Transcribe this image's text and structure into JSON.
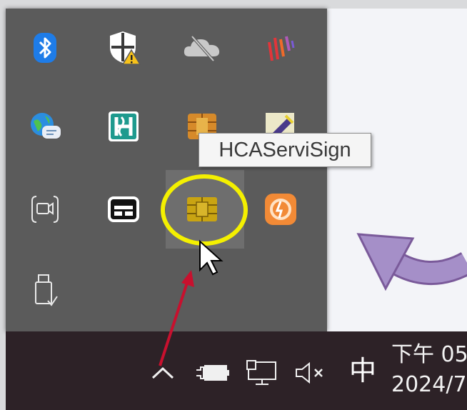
{
  "tooltip": {
    "text": "HCAServiSign"
  },
  "tray": {
    "icons": [
      {
        "name": "bluetooth-icon",
        "row": 1,
        "col": 1
      },
      {
        "name": "windows-security-warning-icon",
        "row": 1,
        "col": 2
      },
      {
        "name": "onedrive-offline-icon",
        "row": 1,
        "col": 3
      },
      {
        "name": "app-stripes-icon",
        "row": 1,
        "col": 4
      },
      {
        "name": "globe-chat-icon",
        "row": 2,
        "col": 1
      },
      {
        "name": "bank-h-logo-icon",
        "row": 2,
        "col": 2
      },
      {
        "name": "chip-card-orange-icon",
        "row": 2,
        "col": 3
      },
      {
        "name": "pen-tool-icon",
        "row": 2,
        "col": 4
      },
      {
        "name": "camera-icon",
        "row": 3,
        "col": 1
      },
      {
        "name": "display-panel-icon",
        "row": 3,
        "col": 2
      },
      {
        "name": "hcaservisign-chip-icon",
        "row": 3,
        "col": 3
      },
      {
        "name": "orange-app-icon",
        "row": 3,
        "col": 4
      },
      {
        "name": "usb-eject-icon",
        "row": 4,
        "col": 1
      }
    ]
  },
  "taskbar": {
    "ime_label": "中",
    "clock_time": "下午 05",
    "clock_date": "2024/7"
  },
  "colors": {
    "tray_bg": "#5b5b5b",
    "taskbar_bg": "#2d2227",
    "highlight_circle": "#f4f000",
    "red_arrow": "#c8102e",
    "curved_arrow": "#a58fc8"
  }
}
